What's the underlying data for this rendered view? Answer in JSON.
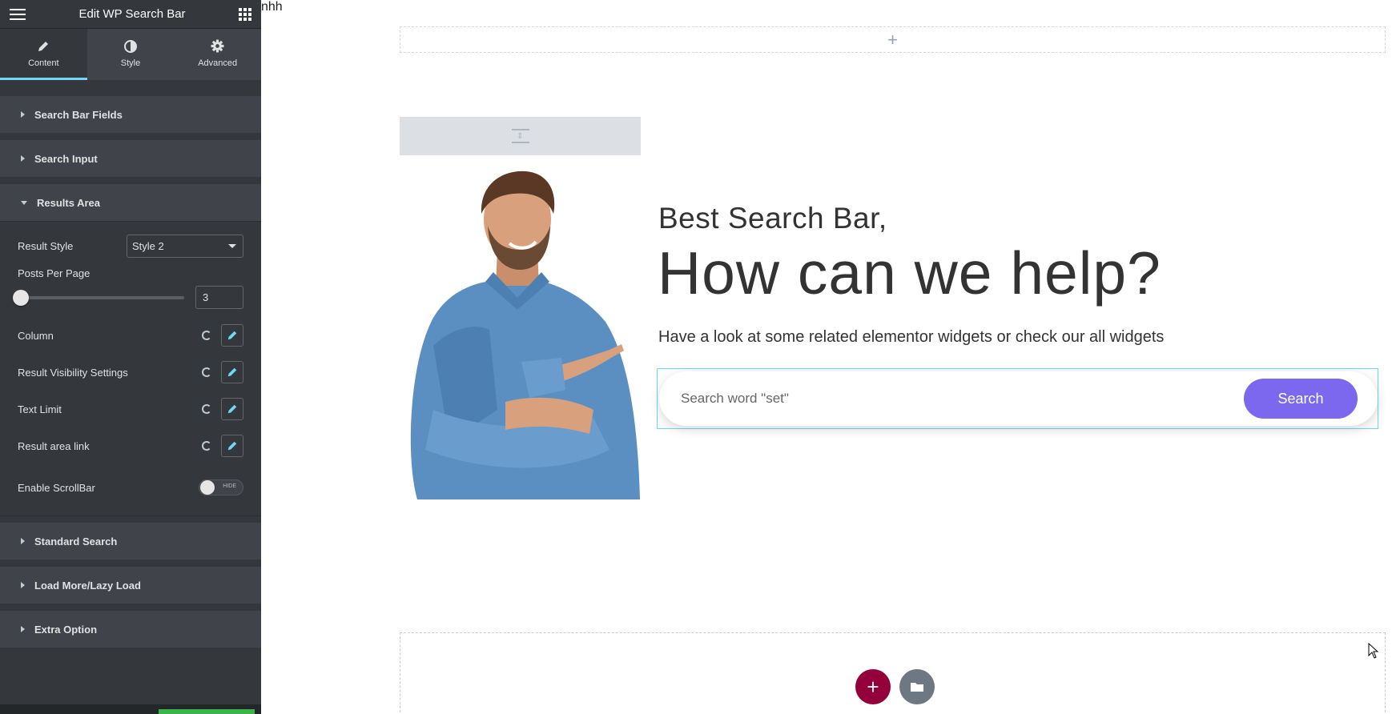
{
  "sidebar": {
    "title": "Edit WP Search Bar",
    "tabs": [
      {
        "label": "Content",
        "icon": "pencil-icon"
      },
      {
        "label": "Style",
        "icon": "half-circle-icon"
      },
      {
        "label": "Advanced",
        "icon": "gear-icon"
      }
    ],
    "sections": {
      "search_bar_fields": "Search Bar Fields",
      "search_input": "Search Input",
      "results_area": "Results Area",
      "standard_search": "Standard Search",
      "load_more": "Load More/Lazy Load",
      "extra_option": "Extra Option"
    },
    "results_area": {
      "result_style_label": "Result Style",
      "result_style_value": "Style 2",
      "posts_per_page_label": "Posts Per Page",
      "posts_per_page_value": "3",
      "column_label": "Column",
      "visibility_label": "Result Visibility Settings",
      "text_limit_label": "Text Limit",
      "area_link_label": "Result area link",
      "scrollbar_label": "Enable ScrollBar",
      "scrollbar_toggle_text": "HIDE"
    }
  },
  "canvas": {
    "top_text": "nhh",
    "hero": {
      "subtitle": "Best Search Bar,",
      "title": "How can we help?",
      "description": "Have a look at some related elementor widgets or check our all widgets"
    },
    "search": {
      "placeholder": "Search word \"set\"",
      "button_label": "Search"
    }
  },
  "colors": {
    "sidebar_bg": "#34383c",
    "section_bg": "#404349",
    "active_tab_accent": "#71d7f7",
    "search_button": "#7b68ee",
    "add_button": "#93003c",
    "folder_button": "#6d7882"
  }
}
